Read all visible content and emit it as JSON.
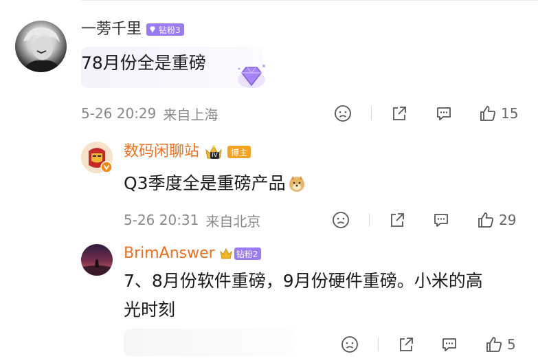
{
  "comments": [
    {
      "username": "一蒡千里",
      "fan_badge": "钻粉3",
      "text": "78月份全是重磅",
      "time": "5-26 20:29",
      "location": "来自上海",
      "likes": "15"
    },
    {
      "username": "数码闲聊站",
      "level_badge": "IV",
      "host_badge": "博主",
      "text": "Q3季度全是重磅产品",
      "time": "5-26 20:31",
      "location": "来自北京",
      "likes": "29"
    },
    {
      "username": "BrimAnswer",
      "fan_badge": "钻粉2",
      "text_line1": "7、8月份软件重磅，9月份硬件重磅。小米的高",
      "text_line2": "光时刻",
      "likes": "5"
    }
  ],
  "colors": {
    "username_gray": "#333333",
    "username_orange": "#f26d1b",
    "fan_badge_purple": "#9b7bf5",
    "host_badge_orange": "#f7a21d",
    "meta_gray": "#888888"
  },
  "icons": {
    "dislike": "sad-face-icon",
    "share": "share-icon",
    "reply": "comment-icon",
    "like": "thumbs-up-icon"
  }
}
